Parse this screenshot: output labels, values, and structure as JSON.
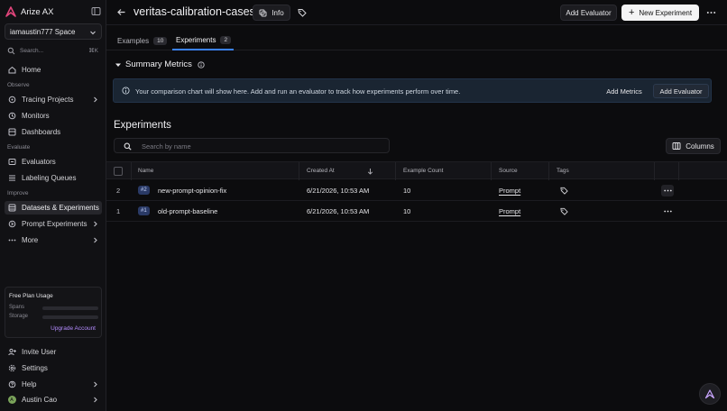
{
  "sidebar": {
    "brand": "Arize AX",
    "space": "iamaustin777 Space",
    "search_label": "Search...",
    "search_shortcut": "⌘K",
    "home": "Home",
    "sections": {
      "observe": "Observe",
      "evaluate": "Evaluate",
      "improve": "Improve"
    },
    "tracing_projects": "Tracing Projects",
    "monitors": "Monitors",
    "dashboards": "Dashboards",
    "evaluators": "Evaluators",
    "labeling_queues": "Labeling Queues",
    "datasets": "Datasets & Experiments",
    "prompt_experiments": "Prompt Experiments",
    "more": "More",
    "plan": {
      "title": "Free Plan Usage",
      "spans_label": "Spans",
      "storage_label": "Storage",
      "spans_usage": 0,
      "storage_usage": 0,
      "upgrade": "Upgrade Account"
    },
    "invite_user": "Invite User",
    "settings": "Settings",
    "help": "Help",
    "user_name": "Austin Cao",
    "user_initial": "A"
  },
  "header": {
    "title": "veritas-calibration-cases",
    "info_label": "Info",
    "add_evaluator": "Add Evaluator",
    "new_experiment": "New Experiment"
  },
  "tabs": [
    {
      "label": "Examples",
      "count": "10"
    },
    {
      "label": "Experiments",
      "count": "2"
    }
  ],
  "summary": {
    "title": "Summary Metrics",
    "banner_text": "Your comparison chart will show here. Add and run an evaluator to track how experiments perform over time.",
    "add_metrics": "Add Metrics",
    "add_evaluator": "Add Evaluator"
  },
  "experiments": {
    "title": "Experiments",
    "search_placeholder": "Search by name",
    "columns_button": "Columns",
    "headers": {
      "name": "Name",
      "created_at": "Created At",
      "example_count": "Example Count",
      "source": "Source",
      "tags": "Tags"
    },
    "rows": [
      {
        "index": "2",
        "badge": "#2",
        "name": "new-prompt-opinion-fix",
        "created_at": "6/21/2026, 10:53 AM",
        "example_count": "10",
        "source": "Prompt"
      },
      {
        "index": "1",
        "badge": "#1",
        "name": "old-prompt-baseline",
        "created_at": "6/21/2026, 10:53 AM",
        "example_count": "10",
        "source": "Prompt"
      }
    ]
  },
  "colors": {
    "accent": "#3b82f6",
    "brand": "#e0457b",
    "upgrade": "#b48cff"
  }
}
